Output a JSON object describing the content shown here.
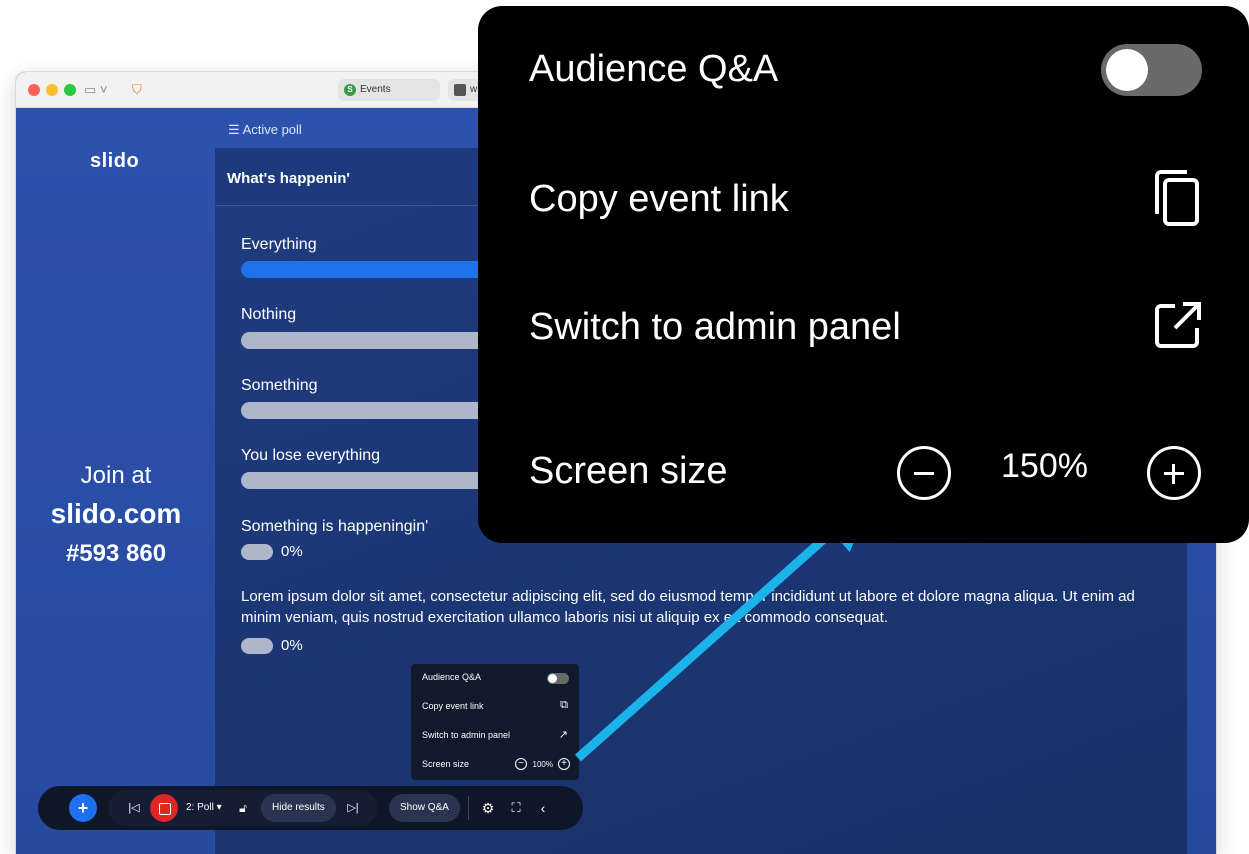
{
  "browser": {
    "tabs": [
      {
        "label": "Events",
        "favicon": "S"
      },
      {
        "label": "w",
        "favicon": ""
      }
    ]
  },
  "sidebar": {
    "logo": "slido",
    "join_at": "Join at",
    "join_url": "slido.com",
    "event_code": "#593 860"
  },
  "poll": {
    "section_label": "Active poll",
    "title": "What's happenin'",
    "options": [
      {
        "label": "Everything",
        "fill": 1.0
      },
      {
        "label": "Nothing",
        "fill": 0
      },
      {
        "label": "Something",
        "fill": 0
      },
      {
        "label": "You lose everything",
        "fill": 0
      }
    ],
    "option_5": {
      "label": "Something is happeningin'",
      "percent": "0%"
    },
    "option_6": {
      "label": "Lorem ipsum dolor sit amet, consectetur adipiscing elit, sed do eiusmod tempor incididunt ut labore et dolore magna aliqua. Ut enim ad minim veniam, quis nostrud exercitation ullamco laboris nisi ut aliquip ex ea commodo consequat.",
      "percent": "0%"
    }
  },
  "menu": {
    "audience_qa": "Audience Q&A",
    "copy_link": "Copy event link",
    "switch_admin": "Switch to admin panel",
    "screen_size": "Screen size",
    "small_zoom": "100%",
    "big_zoom": "150%"
  },
  "controls": {
    "poll_selector": "2: Poll",
    "hide_results": "Hide results",
    "show_qa": "Show Q&A"
  },
  "colors": {
    "accent": "#1e73e8",
    "stop": "#e02525",
    "arrow": "#1bb4ea"
  }
}
